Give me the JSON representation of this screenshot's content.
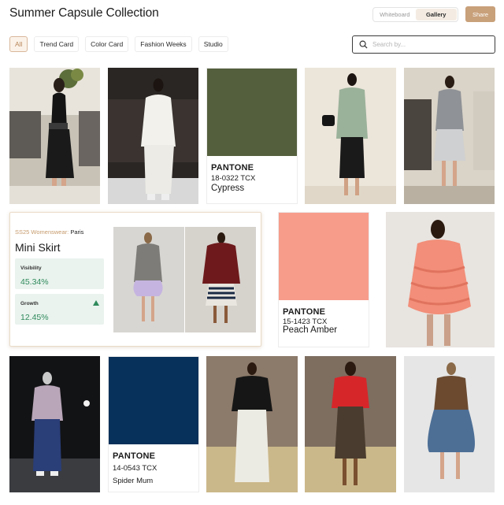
{
  "header": {
    "title": "Summer Capsule Collection",
    "view_toggle": [
      "Whiteboard",
      "Gallery"
    ],
    "active_view": "Gallery",
    "share_label": "Share"
  },
  "filters": [
    "All",
    "Trend Card",
    "Color Card",
    "Fashion Weeks",
    "Studio"
  ],
  "active_filter": "All",
  "search": {
    "placeholder": "Search by..."
  },
  "colors": {
    "accent": "#c8a07a",
    "growth_green": "#2f8a5c",
    "metric_bg": "#eaf3ee"
  },
  "gallery": {
    "swatches": [
      {
        "brand": "PANTONE",
        "code": "18-0322 TCX",
        "name": "Cypress",
        "hex": "#545f3d"
      },
      {
        "brand": "PANTONE",
        "code": "15-1423 TCX",
        "name": "Peach Amber",
        "hex": "#f79c8b"
      },
      {
        "brand": "PANTONE",
        "code": "14-0543 TCX",
        "name": "Spider Mum",
        "hex": "#07305a"
      }
    ],
    "trend_card": {
      "season": "SS25 Womenswear:",
      "city": "Paris",
      "title": "Mini Skirt",
      "metrics": [
        {
          "label": "Visibility",
          "value": "45.34%"
        },
        {
          "label": "Growth",
          "value": "12.45%",
          "trend": "up"
        }
      ]
    }
  }
}
